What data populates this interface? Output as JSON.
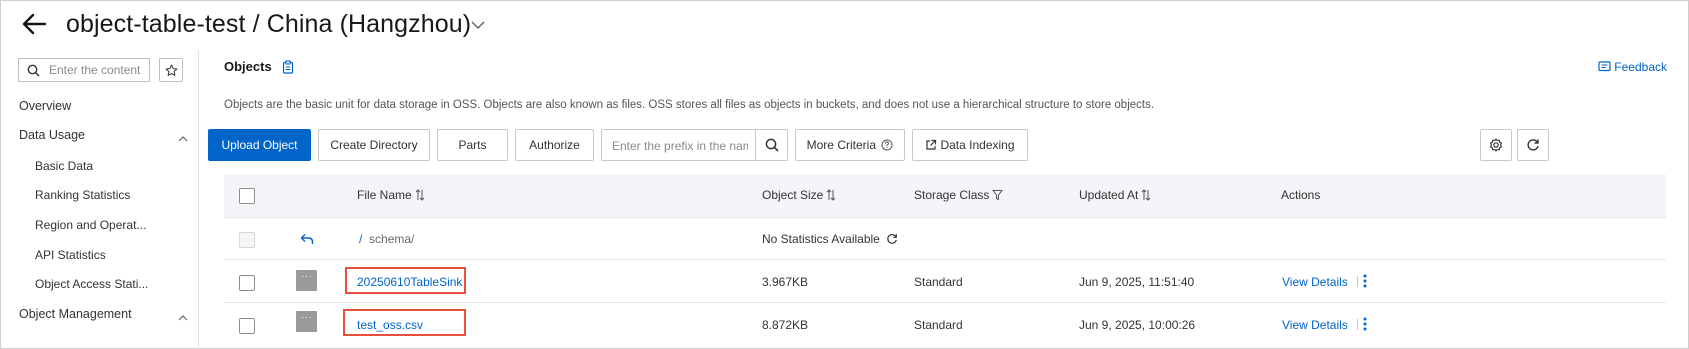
{
  "header": {
    "title": "object-table-test / China (Hangzhou)"
  },
  "sidebar": {
    "search_placeholder": "Enter the content",
    "items": {
      "overview": "Overview",
      "data_usage": "Data Usage",
      "basic_data": "Basic Data",
      "ranking_statistics": "Ranking Statistics",
      "region_operation": "Region and Operat...",
      "api_statistics": "API Statistics",
      "object_access": "Object Access Stati...",
      "object_management": "Object Management"
    }
  },
  "main": {
    "title": "Objects",
    "feedback": "Feedback",
    "description": "Objects are the basic unit for data storage in OSS. Objects are also known as files. OSS stores all files as objects in buckets, and does not use a hierarchical structure to store objects.",
    "toolbar": {
      "upload": "Upload Object",
      "create_directory": "Create Directory",
      "parts": "Parts",
      "authorize": "Authorize",
      "prefix_placeholder": "Enter the prefix in the name",
      "more_criteria": "More Criteria",
      "data_indexing": "Data Indexing"
    },
    "table": {
      "columns": {
        "file_name": "File Name",
        "object_size": "Object Size",
        "storage_class": "Storage Class",
        "updated_at": "Updated At",
        "actions": "Actions"
      },
      "parent_row": {
        "path_prefix": "/",
        "path": "schema/",
        "size": "No Statistics Available"
      },
      "rows": [
        {
          "name": "20250610TableSink",
          "size": "3.967KB",
          "storage_class": "Standard",
          "updated_at": "Jun 9, 2025, 11:51:40",
          "action": "View Details"
        },
        {
          "name": "test_oss.csv",
          "size": "8.872KB",
          "storage_class": "Standard",
          "updated_at": "Jun 9, 2025, 10:00:26",
          "action": "View Details"
        }
      ]
    }
  }
}
